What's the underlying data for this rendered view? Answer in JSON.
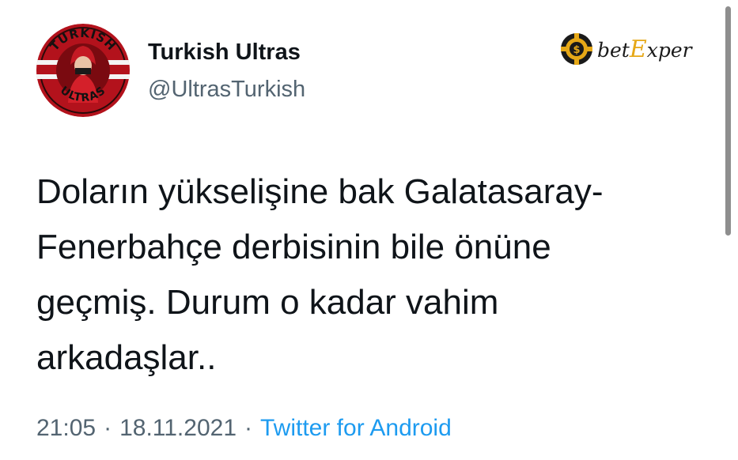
{
  "user": {
    "display_name": "Turkish Ultras",
    "handle": "@UltrasTurkish",
    "avatar_text_top": "TURKISH",
    "avatar_text_bottom": "ULTRAS"
  },
  "watermark": {
    "brand_prefix": "bet",
    "brand_accent": "E",
    "brand_suffix": "xper"
  },
  "tweet": {
    "lines": [
      "Doların yükselişine bak Galatasaray-",
      "Fenerbahçe derbisinin bile önüne",
      "geçmiş. Durum o kadar vahim",
      "arkadaşlar.."
    ]
  },
  "meta": {
    "time": "21:05",
    "date": "18.11.2021",
    "separator": "·",
    "source": "Twitter for Android"
  },
  "colors": {
    "text": "#0f1419",
    "secondary": "#536471",
    "link": "#1d9bf0",
    "avatar_red": "#b3121c",
    "brand_gold": "#e6a817"
  }
}
